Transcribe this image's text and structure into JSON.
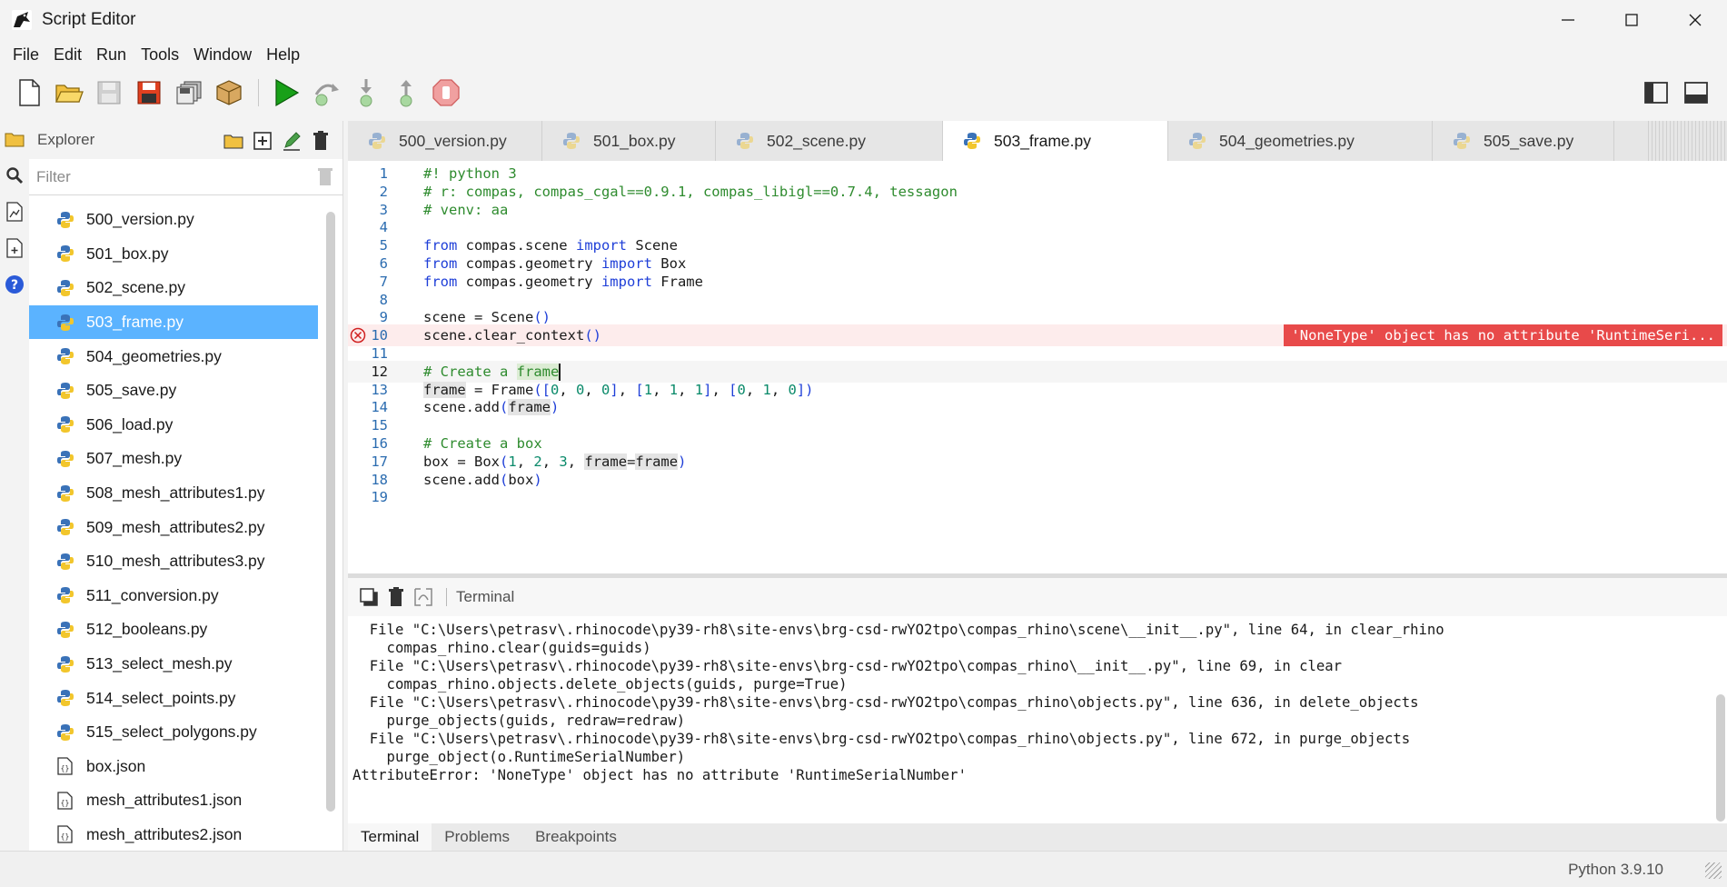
{
  "window": {
    "title": "Script Editor"
  },
  "menu": [
    "File",
    "Edit",
    "Run",
    "Tools",
    "Window",
    "Help"
  ],
  "explorer": {
    "title": "Explorer",
    "filter_placeholder": "Filter",
    "files": [
      {
        "name": "500_version.py",
        "type": "py"
      },
      {
        "name": "501_box.py",
        "type": "py"
      },
      {
        "name": "502_scene.py",
        "type": "py"
      },
      {
        "name": "503_frame.py",
        "type": "py",
        "selected": true
      },
      {
        "name": "504_geometries.py",
        "type": "py"
      },
      {
        "name": "505_save.py",
        "type": "py"
      },
      {
        "name": "506_load.py",
        "type": "py"
      },
      {
        "name": "507_mesh.py",
        "type": "py"
      },
      {
        "name": "508_mesh_attributes1.py",
        "type": "py"
      },
      {
        "name": "509_mesh_attributes2.py",
        "type": "py"
      },
      {
        "name": "510_mesh_attributes3.py",
        "type": "py"
      },
      {
        "name": "511_conversion.py",
        "type": "py"
      },
      {
        "name": "512_booleans.py",
        "type": "py"
      },
      {
        "name": "513_select_mesh.py",
        "type": "py"
      },
      {
        "name": "514_select_points.py",
        "type": "py"
      },
      {
        "name": "515_select_polygons.py",
        "type": "py"
      },
      {
        "name": "box.json",
        "type": "json"
      },
      {
        "name": "mesh_attributes1.json",
        "type": "json"
      },
      {
        "name": "mesh_attributes2.json",
        "type": "json"
      }
    ]
  },
  "tabs": [
    {
      "label": "500_version.py",
      "width": 214
    },
    {
      "label": "501_box.py",
      "width": 191
    },
    {
      "label": "502_scene.py",
      "width": 250
    },
    {
      "label": "503_frame.py",
      "width": 248,
      "active": true
    },
    {
      "label": "504_geometries.py",
      "width": 291
    },
    {
      "label": "505_save.py",
      "width": 200
    }
  ],
  "editor": {
    "current_line": 12,
    "error_line": 10,
    "error_message": "'NoneType' object has no attribute 'RuntimeSeri...",
    "lines": [
      {
        "n": "1",
        "tokens": [
          [
            "cm",
            "#! python 3"
          ]
        ]
      },
      {
        "n": "2",
        "tokens": [
          [
            "cm",
            "# r: compas, compas_cgal==0.9.1, compas_libigl==0.7.4, tessagon"
          ]
        ]
      },
      {
        "n": "3",
        "tokens": [
          [
            "cm",
            "# venv: aa"
          ]
        ]
      },
      {
        "n": "4",
        "tokens": []
      },
      {
        "n": "5",
        "tokens": [
          [
            "kw",
            "from"
          ],
          [
            "",
            " compas.scene "
          ],
          [
            "kw",
            "import"
          ],
          [
            "",
            " Scene"
          ]
        ]
      },
      {
        "n": "6",
        "tokens": [
          [
            "kw",
            "from"
          ],
          [
            "",
            " compas.geometry "
          ],
          [
            "kw",
            "import"
          ],
          [
            "",
            " Box"
          ]
        ]
      },
      {
        "n": "7",
        "tokens": [
          [
            "kw",
            "from"
          ],
          [
            "",
            " compas.geometry "
          ],
          [
            "kw",
            "import"
          ],
          [
            "",
            " Frame"
          ]
        ]
      },
      {
        "n": "8",
        "tokens": []
      },
      {
        "n": "9",
        "tokens": [
          [
            "",
            "scene = Scene"
          ],
          [
            "pr",
            "()"
          ]
        ]
      },
      {
        "n": "10",
        "tokens": [
          [
            "",
            "scene.clear_context"
          ],
          [
            "pr",
            "()"
          ]
        ]
      },
      {
        "n": "11",
        "tokens": []
      },
      {
        "n": "12",
        "tokens": [
          [
            "cm",
            "# Create a "
          ],
          [
            "cmhl",
            "frame"
          ],
          [
            "caret",
            ""
          ]
        ]
      },
      {
        "n": "13",
        "tokens": [
          [
            "hl",
            "frame"
          ],
          [
            "",
            " = Frame"
          ],
          [
            "pr",
            "(["
          ],
          [
            "nm",
            "0"
          ],
          [
            "",
            ", "
          ],
          [
            "nm",
            "0"
          ],
          [
            "",
            ", "
          ],
          [
            "nm",
            "0"
          ],
          [
            "pr",
            "]"
          ],
          [
            "",
            ", "
          ],
          [
            "pr",
            "["
          ],
          [
            "nm",
            "1"
          ],
          [
            "",
            ", "
          ],
          [
            "nm",
            "1"
          ],
          [
            "",
            ", "
          ],
          [
            "nm",
            "1"
          ],
          [
            "pr",
            "]"
          ],
          [
            "",
            ", "
          ],
          [
            "pr",
            "["
          ],
          [
            "nm",
            "0"
          ],
          [
            "",
            ", "
          ],
          [
            "nm",
            "1"
          ],
          [
            "",
            ", "
          ],
          [
            "nm",
            "0"
          ],
          [
            "pr",
            "])"
          ]
        ]
      },
      {
        "n": "14",
        "tokens": [
          [
            "",
            "scene.add"
          ],
          [
            "pr",
            "("
          ],
          [
            "hl",
            "frame"
          ],
          [
            "pr",
            ")"
          ]
        ]
      },
      {
        "n": "15",
        "tokens": []
      },
      {
        "n": "16",
        "tokens": [
          [
            "cm",
            "# Create a box"
          ]
        ]
      },
      {
        "n": "17",
        "tokens": [
          [
            "",
            "box = Box"
          ],
          [
            "pr",
            "("
          ],
          [
            "nm",
            "1"
          ],
          [
            "",
            ", "
          ],
          [
            "nm",
            "2"
          ],
          [
            "",
            ", "
          ],
          [
            "nm",
            "3"
          ],
          [
            "",
            ", "
          ],
          [
            "hl",
            "frame"
          ],
          [
            "",
            "="
          ],
          [
            "hl",
            "frame"
          ],
          [
            "pr",
            ")"
          ]
        ]
      },
      {
        "n": "18",
        "tokens": [
          [
            "",
            "scene.add"
          ],
          [
            "pr",
            "("
          ],
          [
            "",
            "box"
          ],
          [
            "pr",
            ")"
          ]
        ]
      },
      {
        "n": "19",
        "tokens": []
      }
    ]
  },
  "terminal": {
    "title": "Terminal",
    "lines": [
      "  File \"C:\\Users\\petrasv\\.rhinocode\\py39-rh8\\site-envs\\brg-csd-rwYO2tpo\\compas_rhino\\scene\\__init__.py\", line 64, in clear_rhino",
      "    compas_rhino.clear(guids=guids)",
      "  File \"C:\\Users\\petrasv\\.rhinocode\\py39-rh8\\site-envs\\brg-csd-rwYO2tpo\\compas_rhino\\__init__.py\", line 69, in clear",
      "    compas_rhino.objects.delete_objects(guids, purge=True)",
      "  File \"C:\\Users\\petrasv\\.rhinocode\\py39-rh8\\site-envs\\brg-csd-rwYO2tpo\\compas_rhino\\objects.py\", line 636, in delete_objects",
      "    purge_objects(guids, redraw=redraw)",
      "  File \"C:\\Users\\petrasv\\.rhinocode\\py39-rh8\\site-envs\\brg-csd-rwYO2tpo\\compas_rhino\\objects.py\", line 672, in purge_objects",
      "    purge_object(o.RuntimeSerialNumber)",
      "AttributeError: 'NoneType' object has no attribute 'RuntimeSerialNumber'"
    ]
  },
  "bottom_tabs": [
    "Terminal",
    "Problems",
    "Breakpoints"
  ],
  "status": {
    "python_version": "Python 3.9.10"
  },
  "colors": {
    "accent_selection": "#5bb3ff",
    "error": "#e84a4a",
    "keyword": "#1f3fd8",
    "comment": "#2e8b2e"
  }
}
